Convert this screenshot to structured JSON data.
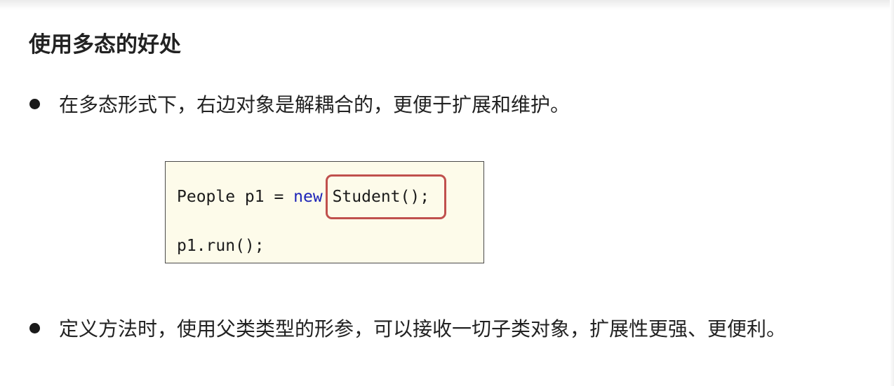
{
  "slide": {
    "title": "使用多态的好处"
  },
  "bullets": [
    {
      "text": "在多态形式下，右边对象是解耦合的，更便于扩展和维护。"
    },
    {
      "text": "定义方法时，使用父类类型的形参，可以接收一切子类对象，扩展性更强、更便利。"
    }
  ],
  "code": {
    "line1_prefix": "People p1 = ",
    "line1_keyword": "new",
    "line1_gap": " ",
    "line1_highlight": "Student();",
    "line2": "p1.run();"
  },
  "colors": {
    "keyword": "#1d24b8",
    "highlight_border": "#c0504d",
    "code_background": "#fdfbea",
    "code_border": "#4a4a4a"
  }
}
